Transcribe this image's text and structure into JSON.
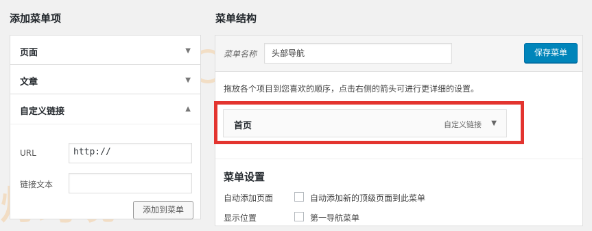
{
  "left": {
    "title": "添加菜单项",
    "items": [
      {
        "label": "页面",
        "arrow": "▼"
      },
      {
        "label": "文章",
        "arrow": "▼"
      },
      {
        "label": "自定义链接",
        "arrow": "▲"
      }
    ],
    "custom_link": {
      "url_label": "URL",
      "url_value": "http://",
      "link_text_label": "链接文本",
      "link_text_value": "",
      "add_button": "添加到菜单"
    }
  },
  "right": {
    "title": "菜单结构",
    "menu_name_label": "菜单名称",
    "menu_name_value": "头部导航",
    "save_button": "保存菜单",
    "instructions": "拖放各个项目到您喜欢的顺序，点击右侧的箭头可进行更详细的设置。",
    "menu_items": [
      {
        "title": "首页",
        "type": "自定义链接",
        "arrow": "▼"
      }
    ],
    "settings": {
      "title": "菜单设置",
      "rows": [
        {
          "label": "自动添加页面",
          "checkbox_label": "自动添加新的顶级页面到此菜单",
          "checked": false
        },
        {
          "label": "显示位置",
          "checkbox_label": "第一导航菜单",
          "checked": false
        }
      ]
    }
  },
  "watermark": {
    "text_1": "科灯跨境",
    "text_2": "灯跨境",
    "text_3": "科灯"
  },
  "colors": {
    "primary": "#0085ba",
    "highlight": "#e3342f",
    "watermark": "#f3cda0"
  }
}
